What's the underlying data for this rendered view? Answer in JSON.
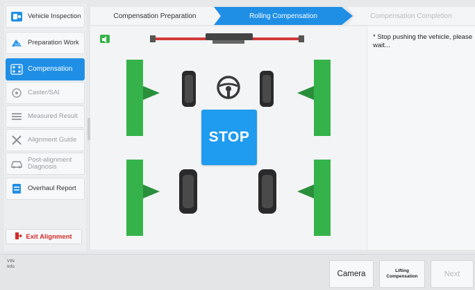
{
  "sidebar": {
    "items": [
      {
        "label": "Vehicle Inspection",
        "icon": "vehicle-inspection-icon"
      },
      {
        "label": "Preparation Work",
        "icon": "preparation-icon"
      },
      {
        "label": "Compensation",
        "icon": "compensation-icon",
        "active": true
      },
      {
        "label": "Caster/SAI",
        "icon": "caster-icon"
      },
      {
        "label": "Measured Result",
        "icon": "measured-result-icon"
      },
      {
        "label": "Alignment Guide",
        "icon": "alignment-guide-icon"
      },
      {
        "label": "Post-alignment Diagnosis",
        "icon": "diagnosis-icon"
      },
      {
        "label": "Overhaul Report",
        "icon": "report-icon"
      }
    ],
    "exit_label": "Exit Alignment"
  },
  "steps": [
    {
      "label": "Compensation Preparation",
      "state": "done"
    },
    {
      "label": "Rolling Compensation",
      "state": "active"
    },
    {
      "label": "Compensation Completion",
      "state": "pending"
    }
  ],
  "main": {
    "stop_label": "STOP",
    "message": "* Stop pushing the vehicle, please wait..."
  },
  "bottom": {
    "vin_label": "VIN",
    "info_label": "Info",
    "camera_label": "Camera",
    "lifting_label_line1": "Lifting",
    "lifting_label_line2": "Compensation",
    "next_label": "Next"
  },
  "colors": {
    "accent": "#1f8fe6",
    "stop_blue": "#1f9bf0",
    "sensor_green": "#35b34a",
    "exit_red": "#d22b2b",
    "beam_red": "#d23a3a"
  }
}
